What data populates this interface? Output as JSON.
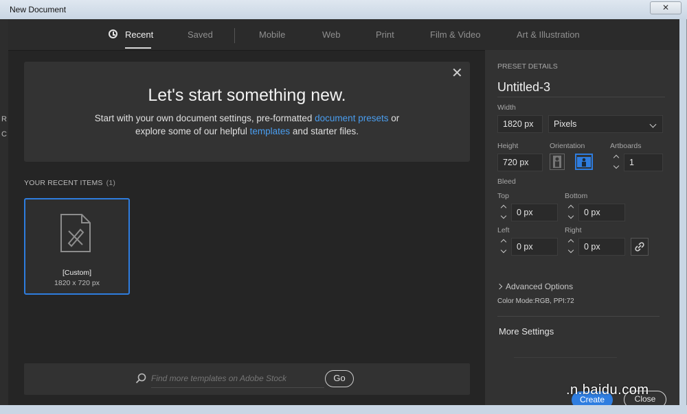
{
  "window": {
    "title": "New Document",
    "close_label": "✕"
  },
  "tabs": [
    {
      "label": "Recent",
      "active": true
    },
    {
      "label": "Saved"
    },
    {
      "label": "Mobile"
    },
    {
      "label": "Web"
    },
    {
      "label": "Print"
    },
    {
      "label": "Film & Video"
    },
    {
      "label": "Art & Illustration"
    }
  ],
  "hero": {
    "title": "Let's start something new.",
    "line1_prefix": "Start with your own document settings, pre-formatted ",
    "line1_link": "document presets",
    "line1_suffix": " or",
    "line2_prefix": "explore some of our helpful ",
    "line2_link": "templates",
    "line2_suffix": " and starter files.",
    "close": "✕"
  },
  "recent": {
    "heading": "YOUR RECENT ITEMS",
    "count": "(1)",
    "items": [
      {
        "name": "[Custom]",
        "size": "1820 x 720 px"
      }
    ]
  },
  "search": {
    "placeholder": "Find more templates on Adobe Stock",
    "go_label": "Go"
  },
  "preset": {
    "heading": "PRESET DETAILS",
    "name": "Untitled-3",
    "width_label": "Width",
    "width_value": "1820 px",
    "unit": "Pixels",
    "height_label": "Height",
    "height_value": "720 px",
    "orientation_label": "Orientation",
    "artboards_label": "Artboards",
    "artboards_value": "1",
    "bleed_label": "Bleed",
    "top_label": "Top",
    "top_value": "0 px",
    "bottom_label": "Bottom",
    "bottom_value": "0 px",
    "left_label": "Left",
    "left_value": "0 px",
    "right_label": "Right",
    "right_value": "0 px",
    "advanced_label": "Advanced Options",
    "color_mode": "Color Mode:RGB, PPI:72",
    "more_settings": "More Settings",
    "create_label": "Create",
    "close_label": "Close"
  },
  "watermark": ".n.baidu.com",
  "side_letters": [
    "R",
    "C"
  ],
  "colors": {
    "accent": "#2e7de0",
    "link": "#4a9ef0",
    "panel": "#323232",
    "background": "#252525"
  }
}
